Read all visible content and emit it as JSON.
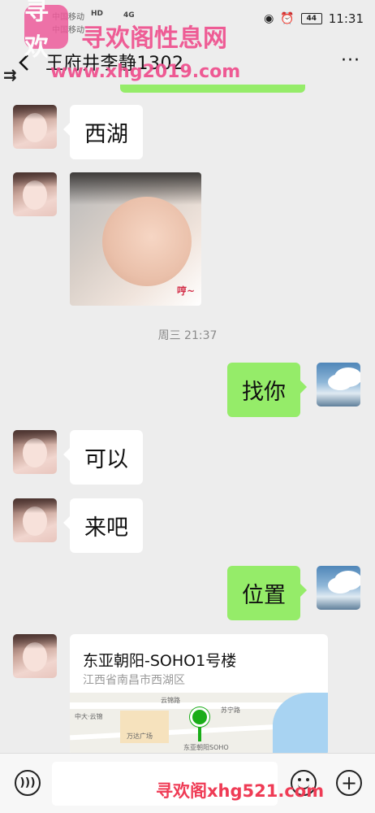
{
  "status_bar": {
    "carrier_1": "中国移动",
    "carrier_2": "中国移动",
    "network_1": "HD",
    "network_2": "4G",
    "battery": "44",
    "time": "11:31"
  },
  "header": {
    "title": "王府井李静1302",
    "more": "···"
  },
  "watermark": {
    "logo_text": "寻欢",
    "site_name": "寻欢阁性息网",
    "url_top": "www.xhg2019.com",
    "url_bottom": "寻欢阁xhg521.com"
  },
  "messages": [
    {
      "side": "in",
      "type": "text",
      "text": "西湖"
    },
    {
      "side": "in",
      "type": "image",
      "sticker": "哼~"
    },
    {
      "type": "time",
      "text": "周三 21:37"
    },
    {
      "side": "out",
      "type": "text",
      "text": "找你"
    },
    {
      "side": "in",
      "type": "text",
      "text": "可以"
    },
    {
      "side": "in",
      "type": "text",
      "text": "来吧"
    },
    {
      "side": "out",
      "type": "text",
      "text": "位置"
    },
    {
      "side": "in",
      "type": "location",
      "name": "东亚朝阳-SOHO1号楼",
      "address": "江西省南昌市西湖区",
      "map_labels": [
        "云锦路",
        "中大·云锦",
        "万达广场",
        "东亚朝阳SOHO",
        "苏宁路"
      ]
    }
  ],
  "input_bar": {
    "placeholder": ""
  },
  "colors": {
    "outgoing_bubble": "#95ec69",
    "incoming_bubble": "#ffffff",
    "background": "#ededed",
    "watermark": "#ef4d8c"
  }
}
